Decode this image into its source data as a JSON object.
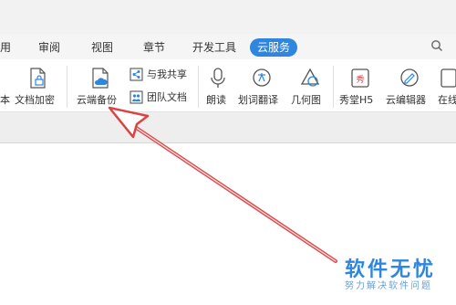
{
  "menu_tabs": {
    "partial_left": "用",
    "review": "审阅",
    "view": "视图",
    "chapter": "章节",
    "dev_tools": "开发工具",
    "cloud_service": "云服务"
  },
  "search": {
    "label": "Q"
  },
  "ribbon": {
    "partial_left_label": "本",
    "doc_encrypt": "文档加密",
    "cloud_backup": "云端备份",
    "share_with_me": "与我共享",
    "team_docs": "团队文档",
    "read_aloud": "朗读",
    "word_translate": "划词翻译",
    "geometry": "几何图",
    "xiutang_h5": "秀堂H5",
    "cloud_editor": "云编辑器",
    "partial_right": "在线"
  },
  "watermark": {
    "title": "软件无忧",
    "subtitle": "努力解决软件问题"
  },
  "colors": {
    "accent": "#2e86de",
    "arrow": "#d94545"
  }
}
